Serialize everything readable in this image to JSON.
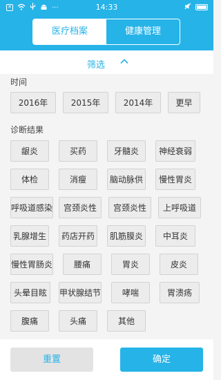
{
  "status_bar": {
    "time": "14:33",
    "icons_left": [
      "notification-icon",
      "wifi-icon",
      "usb-icon",
      "android-icon",
      "more-icon"
    ],
    "icons_right": [
      "mute-icon",
      "battery-icon"
    ]
  },
  "header": {
    "tabs": [
      {
        "label": "医疗档案",
        "active": true
      },
      {
        "label": "健康管理",
        "active": false
      }
    ],
    "accent": "#26b3e8"
  },
  "filter": {
    "label": "筛选",
    "toggle_icon": "chevron-up-icon"
  },
  "time_section": {
    "title": "时间",
    "options": [
      "2016年",
      "2015年",
      "2014年",
      "更早"
    ]
  },
  "diagnosis_section": {
    "title": "诊断结果",
    "options": [
      "龈炎",
      "买药",
      "牙髓炎",
      "神经衰弱",
      "体检",
      "消瘦",
      "脑动脉供",
      "慢性胃炎",
      "呼吸道感染",
      "宫颈炎性",
      "宫颈炎性",
      "上呼吸道",
      "乳腺增生",
      "药店开药",
      "肌筋膜炎",
      "中耳炎",
      "慢性胃肠炎",
      "腰痛",
      "胃炎",
      "皮炎",
      "头晕目眩",
      "甲状腺结节",
      "哮喘",
      "胃溃疡",
      "腹痛",
      "头痛",
      "其他"
    ]
  },
  "actions": {
    "reset_label": "重置",
    "confirm_label": "确定"
  }
}
